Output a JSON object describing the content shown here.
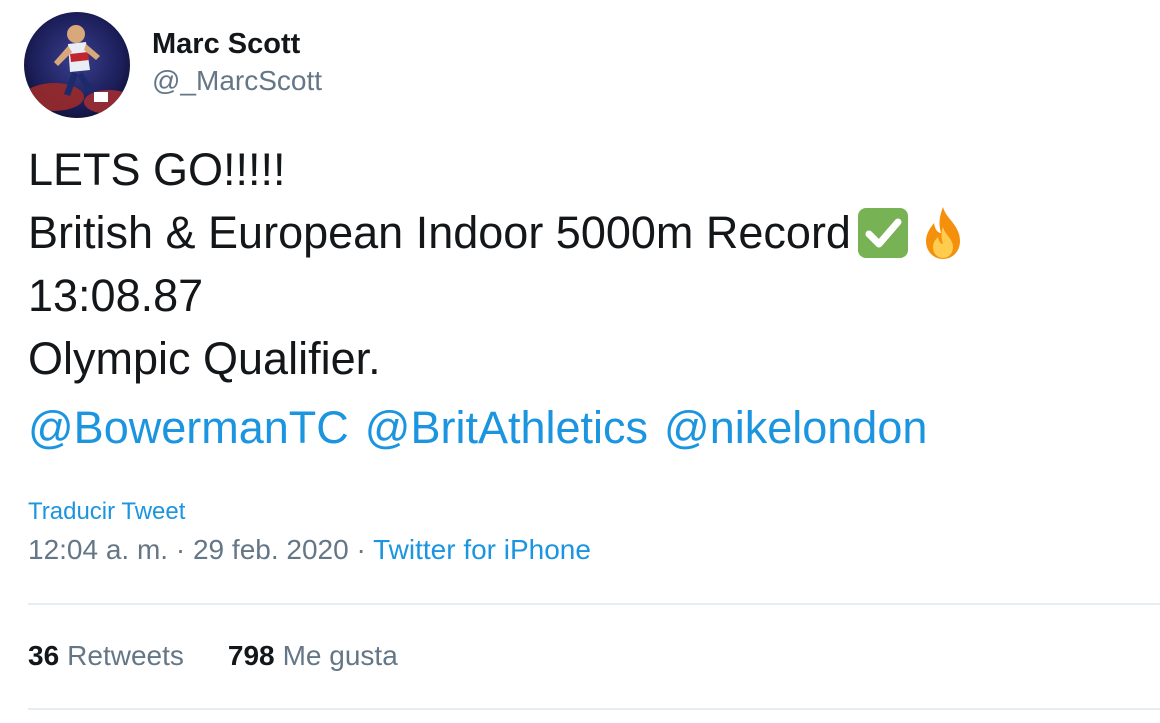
{
  "author": {
    "display_name": "Marc Scott",
    "handle": "@_MarcScott",
    "avatar_icon": "runner-avatar"
  },
  "tweet": {
    "lines": [
      "LETS GO!!!!!",
      "British & European Indoor 5000m Record",
      "13:08.87",
      "Olympic Qualifier."
    ],
    "emojis": [
      "check-mark-icon",
      "fire-icon"
    ],
    "mentions": [
      "@BowermanTC",
      "@BritAthletics",
      "@nikelondon"
    ]
  },
  "translate_label": "Traducir Tweet",
  "meta": {
    "time": "12:04 a. m.",
    "separator": " · ",
    "date": "29 feb. 2020",
    "source": "Twitter for iPhone"
  },
  "stats": {
    "retweets_count": "36",
    "retweets_label": "Retweets",
    "likes_count": "798",
    "likes_label": "Me gusta"
  },
  "colors": {
    "link": "#1b95e0",
    "secondary_text": "#657786",
    "primary_text": "#14171a",
    "divider": "#e6ecf0",
    "check_green": "#77b255"
  }
}
